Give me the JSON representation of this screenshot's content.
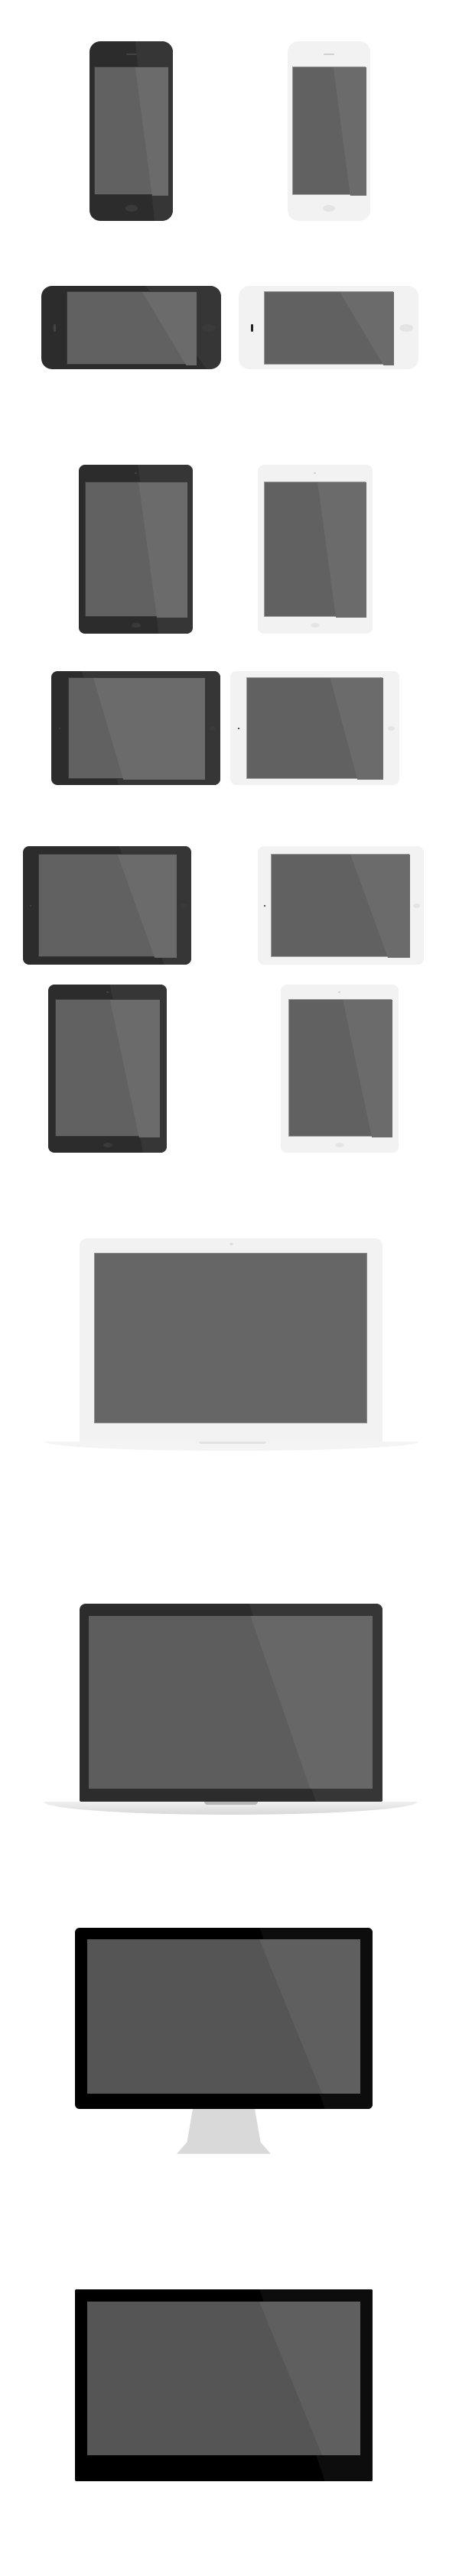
{
  "colors": {
    "background": "#ffffff",
    "dark_body": "#2c2c2c",
    "dark_body_glare": "#363636",
    "white_body": "#f2f2f2",
    "screen": "#616161",
    "screen_glare": "#6b6b6b",
    "monitor_body": "#000000",
    "monitor_screen": "#555555",
    "stand": "#d9d9da"
  },
  "devices": [
    {
      "name": "phone-dark-portrait"
    },
    {
      "name": "phone-white-portrait"
    },
    {
      "name": "phone-dark-landscape"
    },
    {
      "name": "phone-white-landscape"
    },
    {
      "name": "tablet-mini-dark-portrait"
    },
    {
      "name": "tablet-mini-white-portrait"
    },
    {
      "name": "tablet-mini-dark-landscape"
    },
    {
      "name": "tablet-mini-white-landscape"
    },
    {
      "name": "tablet-dark-landscape"
    },
    {
      "name": "tablet-white-landscape"
    },
    {
      "name": "tablet-dark-portrait"
    },
    {
      "name": "tablet-white-portrait"
    },
    {
      "name": "laptop-white"
    },
    {
      "name": "laptop-dark"
    },
    {
      "name": "desktop-monitor"
    },
    {
      "name": "display-monitor"
    }
  ]
}
